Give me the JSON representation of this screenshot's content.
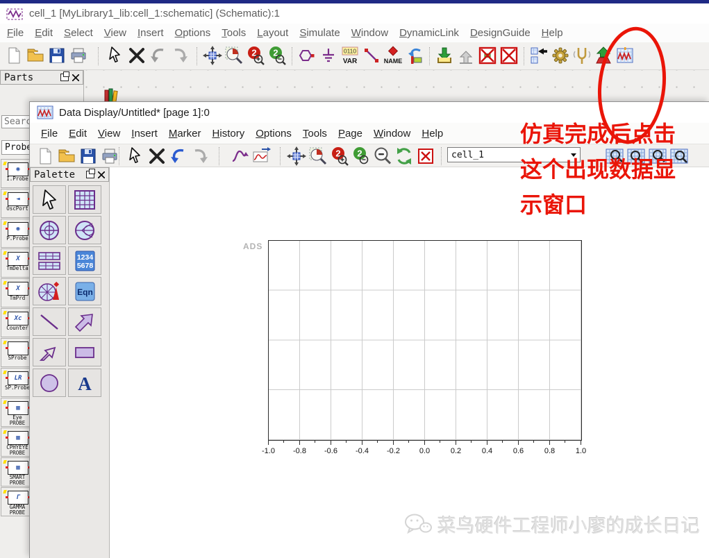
{
  "main_window": {
    "title": "cell_1 [MyLibrary1_lib:cell_1:schematic] (Schematic):1",
    "menus": [
      "File",
      "Edit",
      "Select",
      "View",
      "Insert",
      "Options",
      "Tools",
      "Layout",
      "Simulate",
      "Window",
      "DynamicLink",
      "DesignGuide",
      "Help"
    ],
    "toolbar_icons": [
      "new-file",
      "open-folder",
      "save",
      "print",
      "select-cursor",
      "delete",
      "undo",
      "redo",
      "pan",
      "zoom-area",
      "zoom-in-2x",
      "zoom-out-2x",
      "insert-component",
      "insert-ground",
      "insert-var",
      "insert-wire",
      "insert-name",
      "insert-wire-route",
      "insert-template",
      "activate",
      "deactivate",
      "deactivate-all",
      "push-into-hierarchy",
      "simulation-settings",
      "tune-parameters",
      "simulate",
      "new-data-display"
    ],
    "extra_icons": [
      "recent-parts-clock",
      "library-browser"
    ],
    "var_icon": {
      "top": "0110",
      "label": "VAR"
    },
    "name_icon_label": "NAME"
  },
  "parts_panel": {
    "title": "Parts",
    "search_placeholder": "Search",
    "category": "Probe",
    "items": [
      {
        "label": "I.Probe",
        "glyph": "◉"
      },
      {
        "label": "OscPort",
        "glyph": "◄"
      },
      {
        "label": "P.Probe",
        "glyph": "◉"
      },
      {
        "label": "TmDelta",
        "glyph": "X"
      },
      {
        "label": "TmPrd",
        "glyph": "X"
      },
      {
        "label": "Counter",
        "glyph": "Xc"
      },
      {
        "label": "SProbe",
        "glyph": ""
      },
      {
        "label": "SP.Probe",
        "glyph": "LR"
      },
      {
        "label": "Eye PROBE",
        "glyph": "▦"
      },
      {
        "label": "CPHYEYE PROBE",
        "glyph": "▦"
      },
      {
        "label": "SMART PROBE",
        "glyph": "▦"
      },
      {
        "label": "GAMMA PROBE",
        "glyph": "Γ"
      }
    ]
  },
  "dd_window": {
    "title": "Data Display/Untitled* [page 1]:0",
    "menus": [
      "File",
      "Edit",
      "View",
      "Insert",
      "Marker",
      "History",
      "Options",
      "Tools",
      "Page",
      "Window",
      "Help"
    ],
    "toolbar_icons": [
      "new-file",
      "open-folder",
      "save",
      "print",
      "select-cursor",
      "delete",
      "undo",
      "redo",
      "insert-marker",
      "plot-update",
      "pan",
      "zoom-area",
      "zoom-in-2x",
      "zoom-out-2x",
      "zoom-out",
      "refresh-plot",
      "close-box",
      "dataset-combo",
      "zoom-grid-a",
      "zoom-grid-b",
      "zoom-grid-c",
      "zoom-grid-d"
    ],
    "dataset": "cell_1"
  },
  "palette": {
    "title": "Palette",
    "tools": [
      "select-cursor",
      "rectangular-plot",
      "polar-plot",
      "smith-chart",
      "list-plot",
      "numeric-display",
      "antenna-plot",
      "equation",
      "line",
      "arrow",
      "polyline",
      "rectangle",
      "circle",
      "text"
    ],
    "numeric_icon": {
      "line1": "1234",
      "line2": "5678"
    },
    "equation_icon": "Eqn",
    "text_icon": "A"
  },
  "plot": {
    "brand": "ADS",
    "x_ticks": [
      "-1.0",
      "-0.8",
      "-0.6",
      "-0.4",
      "-0.2",
      "0.0",
      "0.2",
      "0.4",
      "0.6",
      "0.8",
      "1.0"
    ]
  },
  "chart_data": {
    "type": "line",
    "title": "",
    "xlabel": "",
    "ylabel": "",
    "xlim": [
      -1.0,
      1.0
    ],
    "x_tick_step": 0.2,
    "grid": true,
    "series": [],
    "note": "empty rectangular data-display plot, no traces plotted"
  },
  "annotations": {
    "callout_lines": [
      "仿真完成后点击",
      "这个出现数据显",
      "示窗口"
    ],
    "annotation_color": "#ea1508"
  },
  "watermark": {
    "text": "菜鸟硬件工程师小廖的成长日记"
  }
}
